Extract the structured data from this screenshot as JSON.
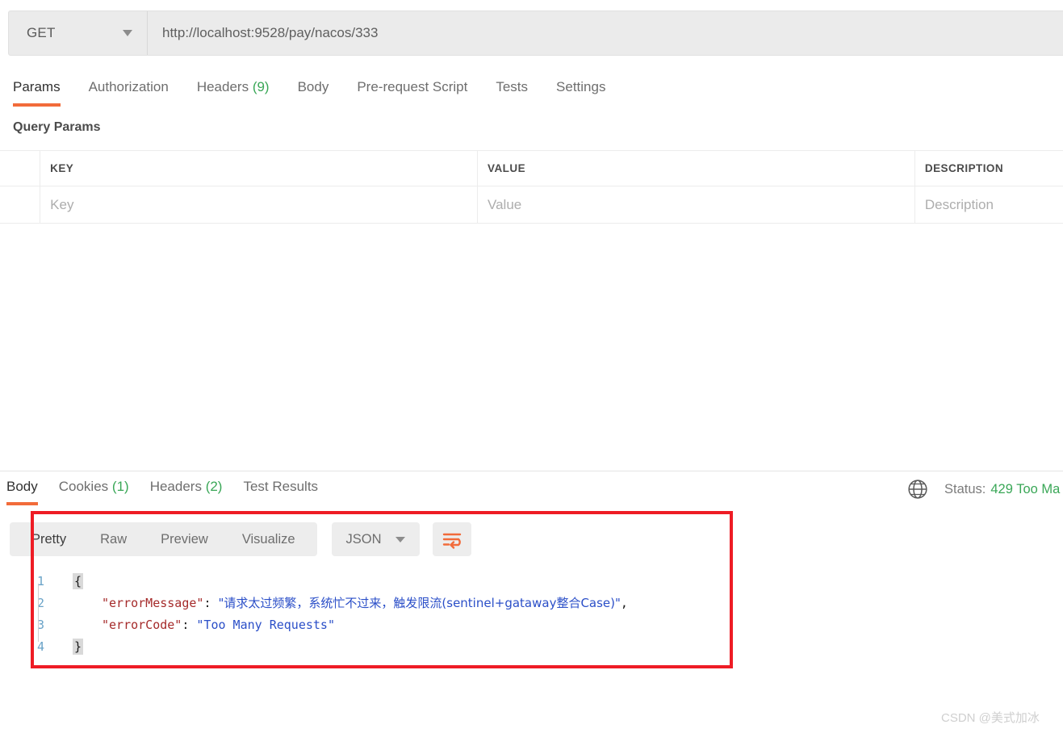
{
  "request": {
    "method": "GET",
    "method_icon": "chevron-down-icon",
    "url": "http://localhost:9528/pay/nacos/333",
    "tabs": [
      {
        "label": "Params",
        "count": "",
        "active": true
      },
      {
        "label": "Authorization",
        "count": "",
        "active": false
      },
      {
        "label": "Headers",
        "count": "(9)",
        "active": false
      },
      {
        "label": "Body",
        "count": "",
        "active": false
      },
      {
        "label": "Pre-request Script",
        "count": "",
        "active": false
      },
      {
        "label": "Tests",
        "count": "",
        "active": false
      },
      {
        "label": "Settings",
        "count": "",
        "active": false
      }
    ]
  },
  "query_params": {
    "title": "Query Params",
    "columns": [
      "",
      "KEY",
      "VALUE",
      "DESCRIPTION"
    ],
    "placeholder_row": [
      "",
      "Key",
      "Value",
      "Description"
    ]
  },
  "response": {
    "tabs": [
      {
        "label": "Body",
        "count": "",
        "active": true
      },
      {
        "label": "Cookies",
        "count": "(1)",
        "active": false
      },
      {
        "label": "Headers",
        "count": "(2)",
        "active": false
      },
      {
        "label": "Test Results",
        "count": "",
        "active": false
      }
    ],
    "network_icon": "globe-icon",
    "status_label": "Status:",
    "status_value": "429 Too Ma",
    "status_color": "#3aa757",
    "toolbar": {
      "view_modes": [
        {
          "label": "Pretty",
          "active": true
        },
        {
          "label": "Raw",
          "active": false
        },
        {
          "label": "Preview",
          "active": false
        },
        {
          "label": "Visualize",
          "active": false
        }
      ],
      "format": "JSON",
      "format_caret_icon": "chevron-down-icon",
      "wrap_icon": "wrap-text-icon",
      "wrap_icon_color": "#f26b3a"
    },
    "body": {
      "language": "json",
      "lines": [
        {
          "no": "1",
          "type": "brace-open",
          "text": "{"
        },
        {
          "no": "2",
          "type": "pair",
          "key": "\"errorMessage\"",
          "sep": ": ",
          "value": "\"请求太过频繁，系统忙不过来，触发限流(sentinel+gataway整合Case)\"",
          "tail": ","
        },
        {
          "no": "3",
          "type": "pair",
          "key": "\"errorCode\"",
          "sep": ": ",
          "value": "\"Too Many Requests\"",
          "tail": ""
        },
        {
          "no": "4",
          "type": "brace-close",
          "text": "}"
        }
      ]
    }
  },
  "annotation": {
    "type": "rectangle-highlight",
    "color": "#ee1c25"
  },
  "watermark": {
    "text": "CSDN @美式加冰"
  }
}
